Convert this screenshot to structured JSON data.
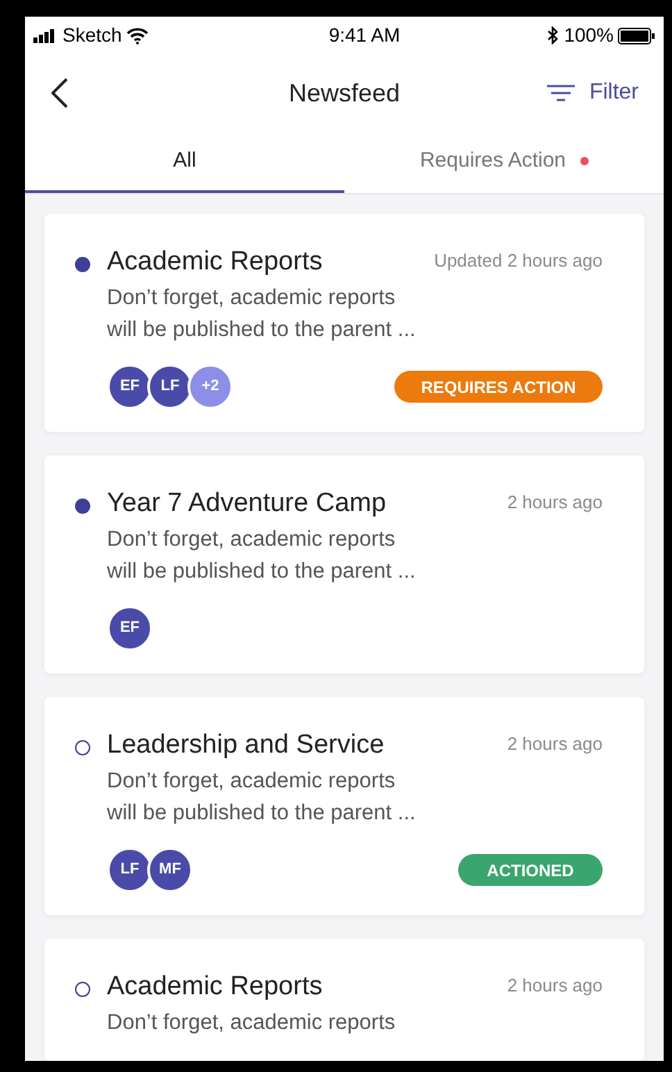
{
  "status_bar": {
    "carrier": "Sketch",
    "time": "9:41 AM",
    "battery": "100%"
  },
  "nav": {
    "title": "Newsfeed",
    "filter": "Filter"
  },
  "tabs": [
    {
      "label": "All",
      "selected": true,
      "alert": false
    },
    {
      "label": "Requires Action",
      "selected": false,
      "alert": true
    }
  ],
  "feed": [
    {
      "title": "Academic Reports",
      "time": "Updated 2 hours ago",
      "unread": true,
      "body": [
        "Don’t forget, academic reports",
        "will be published to the parent ..."
      ],
      "avatars": [
        {
          "text": "EF",
          "kind": "person"
        },
        {
          "text": "LF",
          "kind": "person"
        },
        {
          "text": "+2",
          "kind": "more"
        }
      ],
      "badge": {
        "text": "REQUIRES ACTION",
        "kind": "requires_action"
      }
    },
    {
      "title": "Year 7 Adventure Camp",
      "time": "2 hours ago",
      "unread": true,
      "body": [
        "Don’t forget, academic reports",
        "will be published to the parent ..."
      ],
      "avatars": [
        {
          "text": "EF",
          "kind": "person"
        }
      ]
    },
    {
      "title": "Leadership and Service",
      "time": "2 hours ago",
      "unread": false,
      "body": [
        "Don’t forget, academic reports",
        "will be published to the parent ..."
      ],
      "avatars": [
        {
          "text": "LF",
          "kind": "person"
        },
        {
          "text": "MF",
          "kind": "person"
        }
      ],
      "badge": {
        "text": "ACTIONED",
        "kind": "actioned"
      }
    },
    {
      "title": "Academic Reports",
      "time": "2 hours ago",
      "unread": false,
      "body": [
        "Don’t forget, academic reports"
      ]
    }
  ]
}
